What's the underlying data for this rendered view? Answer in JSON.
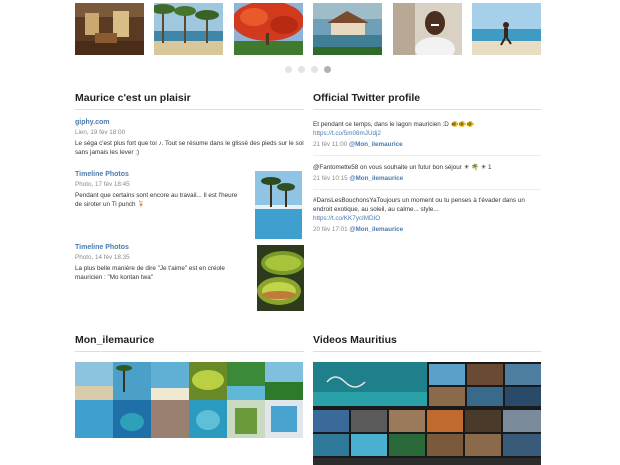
{
  "sections": {
    "facebook_title": "Maurice c'est un plaisir",
    "twitter_title": "Official Twitter profile",
    "instagram_title": "Mon_ilemaurice",
    "videos_title": "Videos Mauritius"
  },
  "thumbnails": [
    {
      "name": "interior-photo"
    },
    {
      "name": "palm-beach-photo"
    },
    {
      "name": "flamboyant-tree-photo"
    },
    {
      "name": "pavilion-lagoon-photo"
    },
    {
      "name": "smiling-man-photo"
    },
    {
      "name": "beach-runner-photo"
    }
  ],
  "carousel": {
    "count": 4,
    "active": 3
  },
  "facebook_posts": [
    {
      "source": "giphy.com",
      "meta": "Lien, 19 fév 18:00",
      "text": "Le séga c'est plus fort que toi ♪. Tout se résume dans le glissé des pieds sur le sol sans jamais les lever :)"
    },
    {
      "source": "Timeline Photos",
      "meta": "Photo, 17 fév 18:45",
      "text": "Pendant que certains sont encore au travail... Il est l'heure de siroter un Ti punch 🍹"
    },
    {
      "source": "Timeline Photos",
      "meta": "Photo, 14 fév 18:35",
      "text": "La plus belle manière de dire \"Je t'aime\" est en créole mauricien : \"Mo kontan twa\""
    }
  ],
  "tweets": [
    {
      "text": "Et pendant ce temps, dans le lagon mauricien :D 🐠🐠🐠",
      "link": "https://t.co/5m08mJUdj2",
      "time": "21 fév 11:00",
      "handle": "@Mon_ilemaurice"
    },
    {
      "text": "@Fantomette58 on vous souhaite un futur bon séjour ☀ 🌴 ☀ 1",
      "link": "",
      "time": "21 fév 10:15",
      "handle": "@Mon_ilemaurice"
    },
    {
      "text": "#DansLesBouchonsYaToujours un moment ou tu penses à t'évader dans un endroit exotique, au soleil, au calme... style...",
      "link": "https://t.co/KK7ycIMDIO",
      "time": "20 fév 17:01",
      "handle": "@Mon_ilemaurice"
    }
  ],
  "colors": {
    "link": "#4a7bb0",
    "muted": "#8a8a8a",
    "dot": "#e3e3e3",
    "dot_active": "#b0b0b0"
  }
}
